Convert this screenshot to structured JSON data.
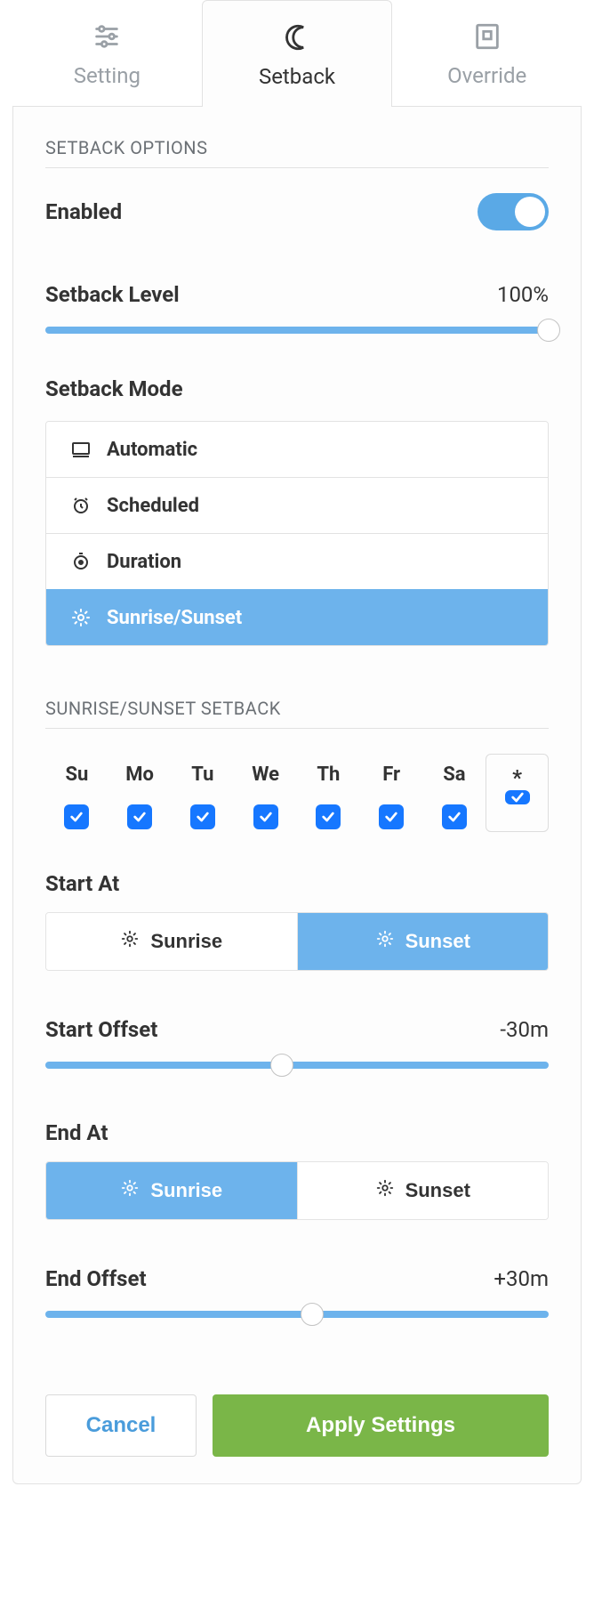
{
  "tabs": {
    "setting": "Setting",
    "setback": "Setback",
    "override": "Override",
    "active": "setback"
  },
  "section": {
    "options_title": "SETBACK OPTIONS",
    "enabled_label": "Enabled",
    "enabled": true,
    "level_label": "Setback Level",
    "level_value": "100%",
    "mode_label": "Setback Mode"
  },
  "modes": {
    "automatic": "Automatic",
    "scheduled": "Scheduled",
    "duration": "Duration",
    "sun": "Sunrise/Sunset",
    "active": "sun"
  },
  "sun": {
    "title": "SUNRISE/SUNSET SETBACK",
    "days": {
      "Su": true,
      "Mo": true,
      "Tu": true,
      "We": true,
      "Th": true,
      "Fr": true,
      "Sa": true
    },
    "all_symbol": "*",
    "all_checked": true,
    "start_at_label": "Start At",
    "start_at": "Sunset",
    "start_offset_label": "Start Offset",
    "start_offset_value": "-30m",
    "end_at_label": "End At",
    "end_at": "Sunrise",
    "end_offset_label": "End Offset",
    "end_offset_value": "+30m",
    "opt_sunrise": "Sunrise",
    "opt_sunset": "Sunset"
  },
  "actions": {
    "cancel": "Cancel",
    "apply": "Apply Settings"
  }
}
